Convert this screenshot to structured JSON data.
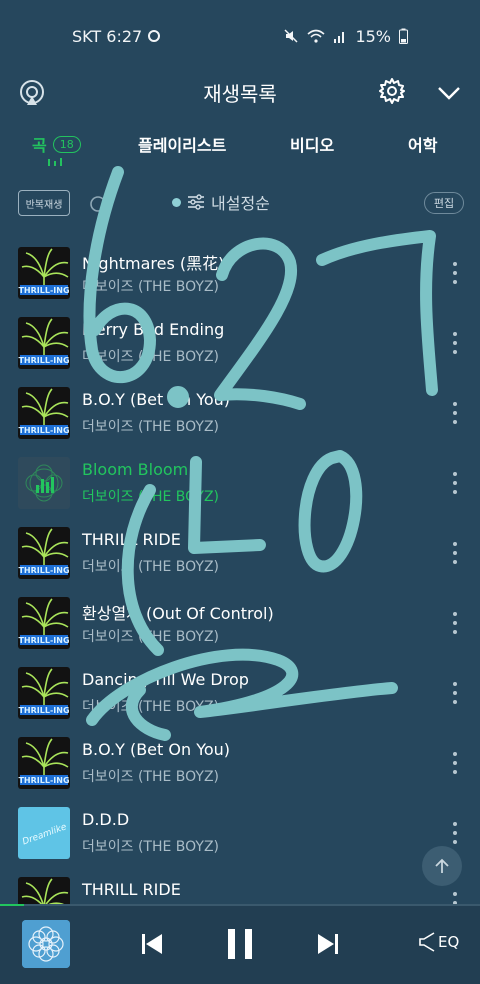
{
  "status_bar": {
    "carrier_time": "SKT 6:27",
    "battery": "15%"
  },
  "header": {
    "title": "재생목록"
  },
  "tabs": [
    {
      "label": "곡",
      "badge": "18"
    },
    {
      "label": "플레이리스트"
    },
    {
      "label": "비디오"
    },
    {
      "label": "어학"
    }
  ],
  "toolbar": {
    "repeat_label": "반복재생",
    "sort_label": "내설정순",
    "edit_label": "편집"
  },
  "songs": [
    {
      "title": "Nightmares (黑花)",
      "artist": "더보이즈 (THE BOYZ)",
      "art": "thrill-ing"
    },
    {
      "title": "Merry Bad Ending",
      "artist": "더보이즈 (THE BOYZ)",
      "art": "thrill-ing"
    },
    {
      "title": "B.O.Y (Bet On You)",
      "artist": "더보이즈 (THE BOYZ)",
      "art": "thrill-ing"
    },
    {
      "title": "Bloom Bloom",
      "artist": "더보이즈 (THE BOYZ)",
      "art": "now-playing",
      "playing": true
    },
    {
      "title": "THRILL RIDE",
      "artist": "더보이즈 (THE BOYZ)",
      "art": "thrill-ing"
    },
    {
      "title": "환상열차 (Out Of Control)",
      "artist": "더보이즈 (THE BOYZ)",
      "art": "thrill-ing"
    },
    {
      "title": "Dancing Till We Drop",
      "artist": "더보이즈 (THE BOYZ)",
      "art": "thrill-ing"
    },
    {
      "title": "B.O.Y (Bet On You)",
      "artist": "더보이즈 (THE BOYZ)",
      "art": "thrill-ing"
    },
    {
      "title": "D.D.D",
      "artist": "더보이즈 (THE BOYZ)",
      "art": "dreamlike"
    },
    {
      "title": "THRILL RIDE",
      "artist": "더보이즈 (THE BOYZ)",
      "art": "thrill-ing"
    }
  ],
  "player": {
    "eq_label": "EQ",
    "progress": 0.05
  },
  "handwriting": [
    "6.27",
    "(ㄴ02)"
  ],
  "colors": {
    "background": "#26475d",
    "accent_green": "#22c55e",
    "handwriting": "#7cc3c6"
  },
  "icons": [
    "cast-icon",
    "gear-icon",
    "chevron-down-icon",
    "more-icon",
    "arrow-up-icon",
    "previous-icon",
    "pause-icon",
    "next-icon",
    "eq-icon"
  ]
}
